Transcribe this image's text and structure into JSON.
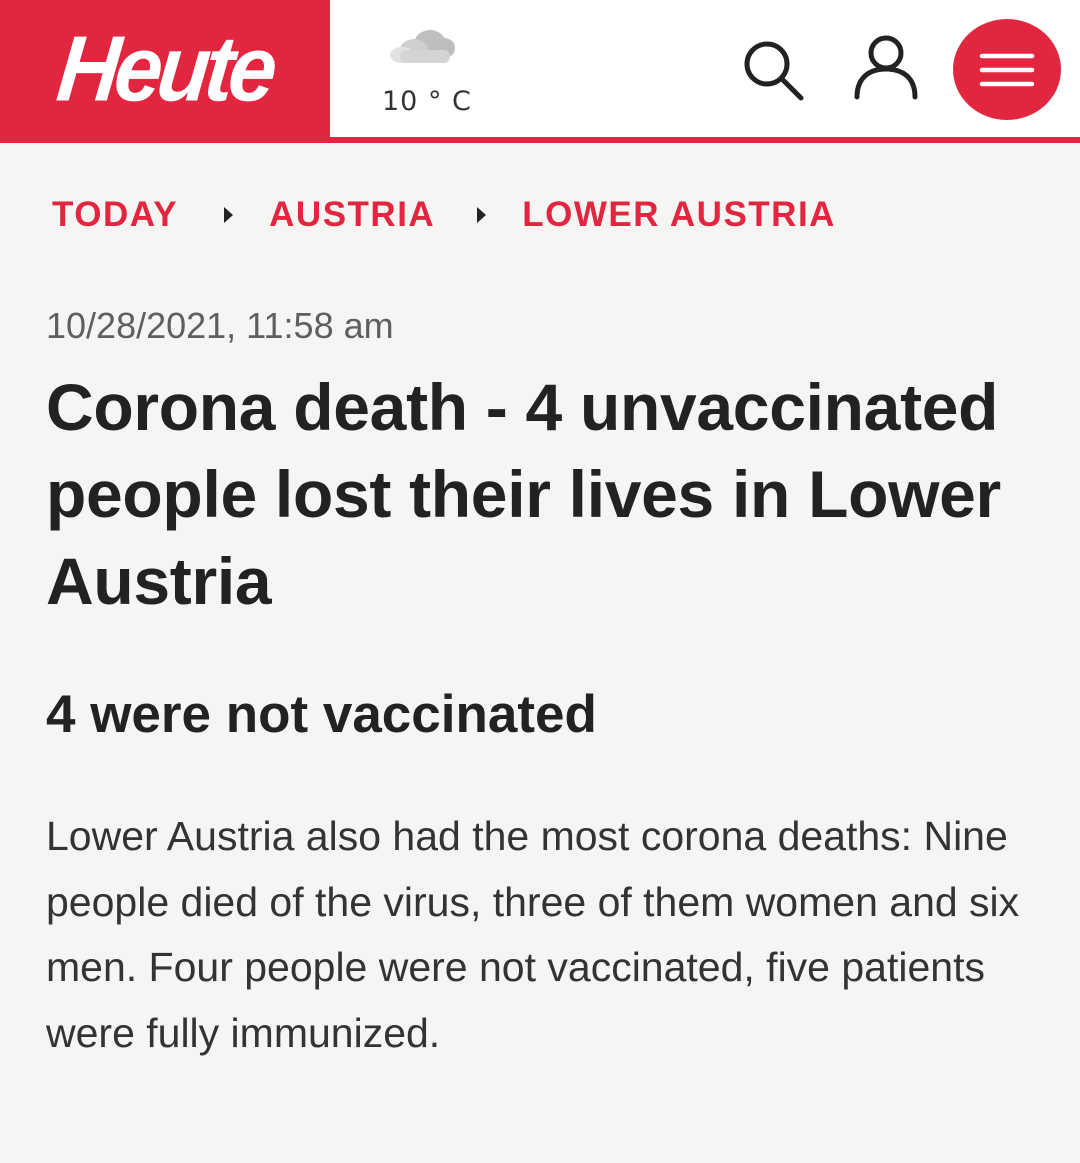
{
  "header": {
    "logo_text": "Heute",
    "weather": {
      "icon": "cloud-icon",
      "temperature": "10 ° C"
    },
    "actions": {
      "search_icon": "search-icon",
      "account_icon": "user-icon",
      "menu_icon": "hamburger-menu-icon"
    }
  },
  "breadcrumb": {
    "items": [
      "TODAY",
      "AUSTRIA",
      "LOWER AUSTRIA"
    ]
  },
  "article": {
    "dateline": "10/28/2021, 11:58 am",
    "headline": "Corona death - 4 unvaccinated people lost their lives in Lower Austria",
    "subheading": "4 were not vaccinated",
    "body": "Lower Austria also had the most corona deaths: Nine people died of the virus, three of them women and six men. Four people were not vaccinated, five patients were fully immunized."
  },
  "colors": {
    "brand_red": "#e3263f",
    "text_dark": "#222222",
    "background": "#f5f5f4"
  }
}
